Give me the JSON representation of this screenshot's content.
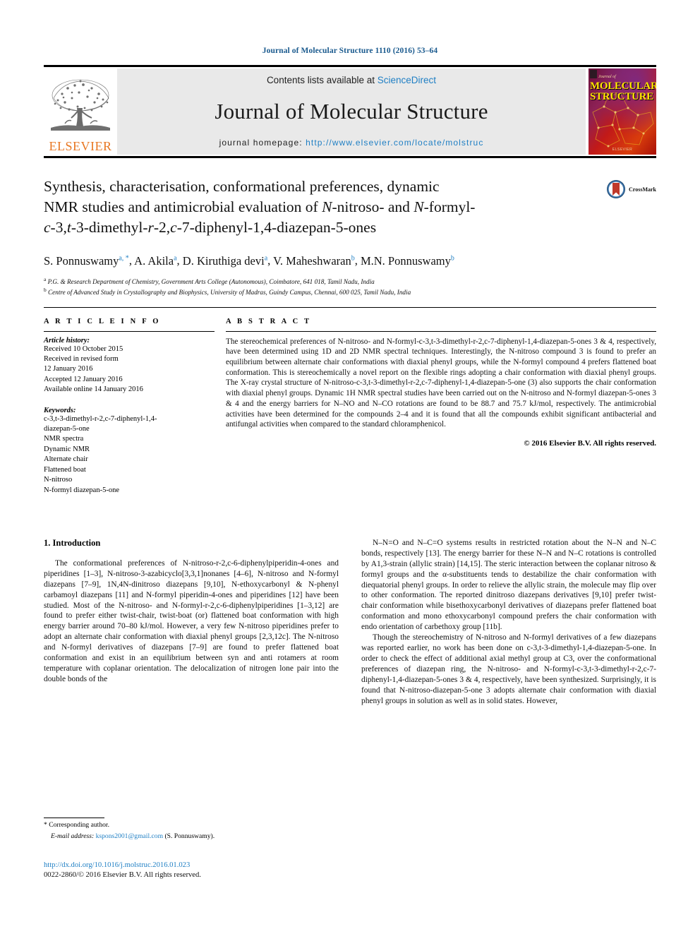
{
  "running_head": "Journal of Molecular Structure 1110 (2016) 53–64",
  "masthead": {
    "contents_prefix": "Contents lists available at ",
    "sciencedirect": "ScienceDirect",
    "journal_name": "Journal of Molecular Structure",
    "homepage_prefix": "journal homepage: ",
    "homepage_url": "http://www.elsevier.com/locate/molstruc",
    "publisher": "ELSEVIER",
    "cover_journal_of": "Journal of",
    "cover_title_line1": "MOLECULAR",
    "cover_title_line2": "STRUCTURE",
    "cover_footer": "ELSEVIER",
    "link_color": "#1f7fc4",
    "elsevier_orange": "#E87722"
  },
  "crossmark": {
    "label": "CrossMark"
  },
  "title": {
    "line1": "Synthesis, characterisation, conformational preferences, dynamic",
    "line2_a": "NMR studies and antimicrobial evaluation of ",
    "line2_i1": "N",
    "line2_b": "-nitroso- and ",
    "line2_i2": "N",
    "line2_c": "-formyl-",
    "line3_i1": "c",
    "line3_a": "-3,",
    "line3_i2": "t",
    "line3_b": "-3-dimethyl-",
    "line3_i3": "r",
    "line3_c": "-2,",
    "line3_i4": "c",
    "line3_d": "-7-diphenyl-1,4-diazepan-5-ones"
  },
  "authors": {
    "list": [
      {
        "name": "S. Ponnuswamy",
        "sup": "a, *"
      },
      {
        "name": "A. Akila",
        "sup": "a"
      },
      {
        "name": "D. Kiruthiga devi",
        "sup": "a"
      },
      {
        "name": "V. Maheshwaran",
        "sup": "b"
      },
      {
        "name": "M.N. Ponnuswamy",
        "sup": "b"
      }
    ],
    "affiliations": [
      {
        "mark": "a",
        "text": "P.G. & Research Department of Chemistry, Government Arts College (Autonomous), Coimbatore, 641 018, Tamil Nadu, India"
      },
      {
        "mark": "b",
        "text": "Centre of Advanced Study in Crystallography and Biophysics, University of Madras, Guindy Campus, Chennai, 600 025, Tamil Nadu, India"
      }
    ]
  },
  "article_info": {
    "heading": "A R T I C L E   I N F O",
    "history_label": "Article history:",
    "history": [
      "Received 10 October 2015",
      "Received in revised form",
      "12 January 2016",
      "Accepted 12 January 2016",
      "Available online 14 January 2016"
    ],
    "keywords_label": "Keywords:",
    "keywords": [
      "c-3,t-3-dimethyl-r-2,c-7-diphenyl-1,4-",
      "diazepan-5-one",
      "NMR spectra",
      "Dynamic NMR",
      "Alternate chair",
      "Flattened boat",
      "N-nitroso",
      "N-formyl diazepan-5-one"
    ]
  },
  "abstract": {
    "heading": "A B S T R A C T",
    "text": "The stereochemical preferences of N-nitroso- and N-formyl-c-3,t-3-dimethyl-r-2,c-7-diphenyl-1,4-diazepan-5-ones 3 & 4, respectively, have been determined using 1D and 2D NMR spectral techniques. Interestingly, the N-nitroso compound 3 is found to prefer an equilibrium between alternate chair conformations with diaxial phenyl groups, while the N-formyl compound 4 prefers flattened boat conformation. This is stereochemically a novel report on the flexible rings adopting a chair conformation with diaxial phenyl groups. The X-ray crystal structure of N-nitroso-c-3,t-3-dimethyl-r-2,c-7-diphenyl-1,4-diazepan-5-one (3) also supports the chair conformation with diaxial phenyl groups. Dynamic 1H NMR spectral studies have been carried out on the N-nitroso and N-formyl diazepan-5-ones 3 & 4 and the energy barriers for N–NO and N–CO rotations are found to be 88.7 and 75.7 kJ/mol, respectively. The antimicrobial activities have been determined for the compounds 2–4 and it is found that all the compounds exhibit significant antibacterial and antifungal activities when compared to the standard chloramphenicol.",
    "copyright": "© 2016 Elsevier B.V. All rights reserved."
  },
  "introduction": {
    "heading": "1.  Introduction",
    "paragraph1": "The conformational preferences of N-nitroso-r-2,c-6-diphenylpiperidin-4-ones and piperidines [1–3], N-nitroso-3-azabicyclo[3,3,1]nonanes [4–6], N-nitroso and N-formyl diazepans [7–9], 1N,4N-dinitroso diazepans [9,10], N-ethoxycarbonyl & N-phenyl carbamoyl diazepans [11] and N-formyl piperidin-4-ones and piperidines [12] have been studied. Most of the N-nitroso- and N-formyl-r-2,c-6-diphenylpiperidines [1–3,12] are found to prefer either twist-chair, twist-boat (or) flattened boat conformation with high energy barrier around 70–80 kJ/mol. However, a very few N-nitroso piperidines prefer to adopt an alternate chair conformation with diaxial phenyl groups [2,3,12c]. The N-nitroso and N-formyl derivatives of diazepans [7–9] are found to prefer flattened boat conformation and exist in an equilibrium between syn and anti rotamers at room temperature with coplanar orientation. The delocalization of nitrogen lone pair into the double bonds of the",
    "paragraph1_cont": "N–N=O and N–C=O systems results in restricted rotation about the N–N and N–C bonds, respectively [13]. The energy barrier for these N–N and N–C rotations is controlled by A1,3-strain (allylic strain) [14,15]. The steric interaction between the coplanar nitroso & formyl groups and the α-substituents tends to destabilize the chair conformation with diequatorial phenyl groups. In order to relieve the allylic strain, the molecule may flip over to other conformation. The reported dinitroso diazepans derivatives [9,10] prefer twist-chair conformation while bisethoxycarbonyl derivatives of diazepans prefer flattened boat conformation and mono ethoxycarbonyl compound prefers the chair conformation with endo orientation of carbethoxy group [11b].",
    "paragraph2": "Though the stereochemistry of N-nitroso and N-formyl derivatives of a few diazepans was reported earlier, no work has been done on c-3,t-3-dimethyl-1,4-diazepan-5-one. In order to check the effect of additional axial methyl group at C3, over the conformational preferences of diazepan ring, the N-nitroso- and N-formyl-c-3,t-3-dimethyl-r-2,c-7-diphenyl-1,4-diazepan-5-ones 3 & 4, respectively, have been synthesized. Surprisingly, it is found that N-nitroso-diazepan-5-one 3 adopts alternate chair conformation with diaxial phenyl groups in solution as well as in solid states. However,"
  },
  "footnote": {
    "corresponding": "* Corresponding author.",
    "email_label": "E-mail address:",
    "email": "kspons2001@gmail.com",
    "email_owner": "(S. Ponnuswamy)."
  },
  "footer": {
    "doi": "http://dx.doi.org/10.1016/j.molstruc.2016.01.023",
    "issn": "0022-2860/© 2016 Elsevier B.V. All rights reserved."
  }
}
